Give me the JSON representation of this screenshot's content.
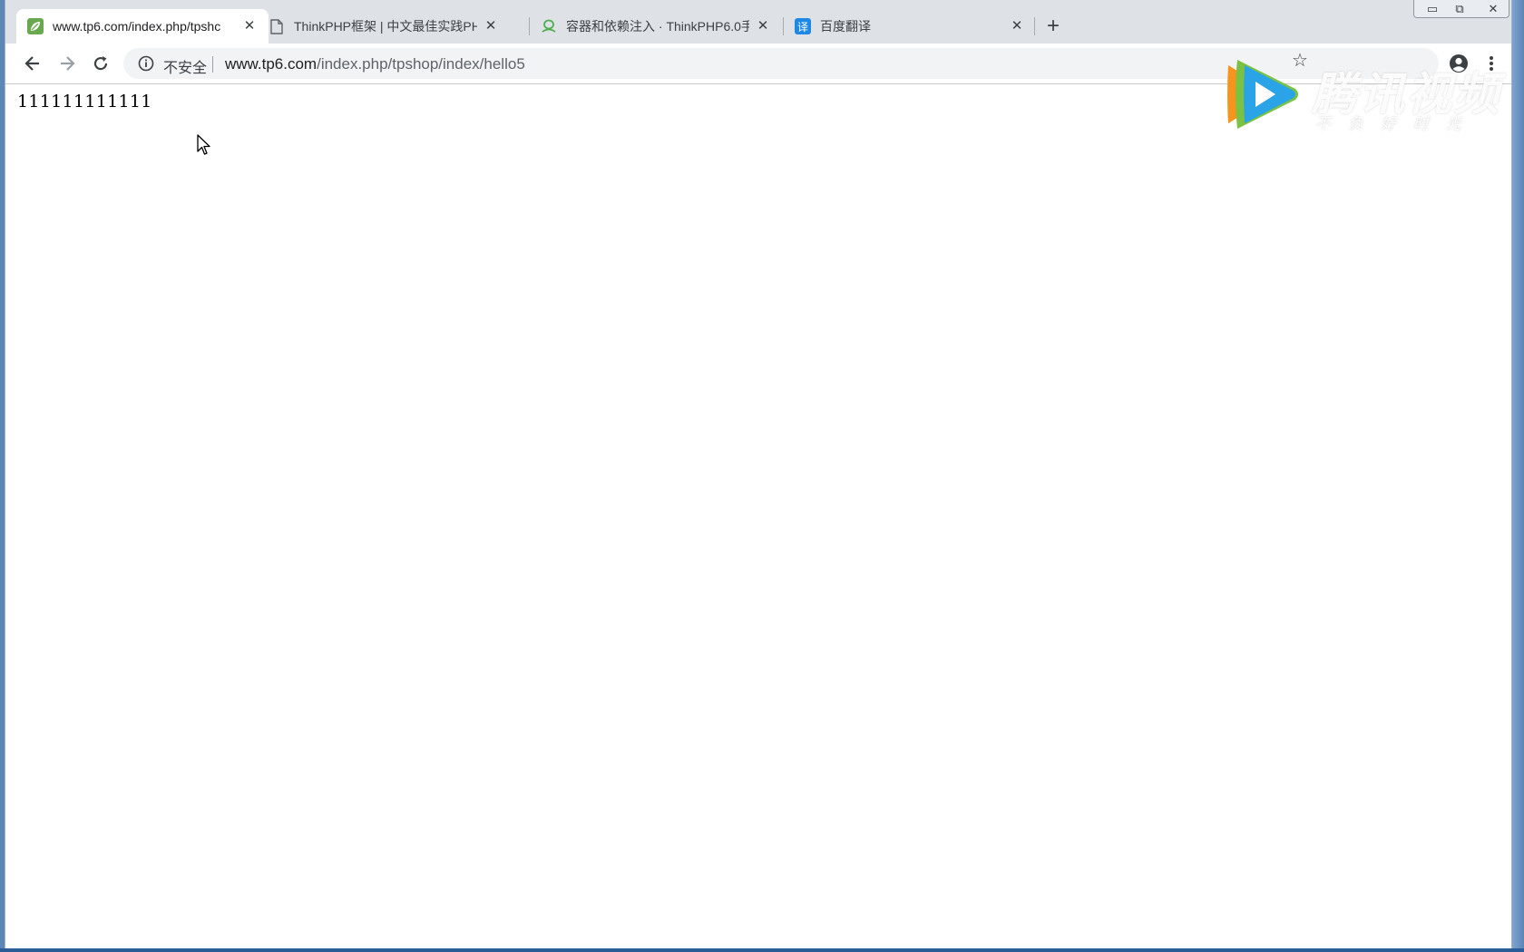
{
  "browser": {
    "tabs": [
      {
        "title": "www.tp6.com/index.php/tpshc",
        "favicon": "leaf-icon",
        "active": true
      },
      {
        "title": "ThinkPHP框架 | 中文最佳实践PH",
        "favicon": "document-icon",
        "active": false
      },
      {
        "title": "容器和依赖注入 · ThinkPHP6.0手",
        "favicon": "kancloud-icon",
        "active": false
      },
      {
        "title": "百度翻译",
        "favicon": "baidu-translate-icon",
        "active": false
      }
    ],
    "tab_close_glyph": "✕",
    "new_tab_glyph": "+",
    "window_controls": {
      "minimize": "▭",
      "restore": "⧉",
      "close": "✕"
    },
    "address_bar": {
      "security_label": "不安全",
      "url_host": "www.tp6.com",
      "url_path": "/index.php/tpshop/index/hello5"
    },
    "bookmark_glyph": "☆"
  },
  "page": {
    "body_text": "111111111111"
  },
  "watermark": {
    "brand": "腾讯视频",
    "slogan": "不负好时光",
    "colors": {
      "orange": "#f7941e",
      "green": "#7cc242",
      "blue": "#2aa4e6"
    }
  }
}
